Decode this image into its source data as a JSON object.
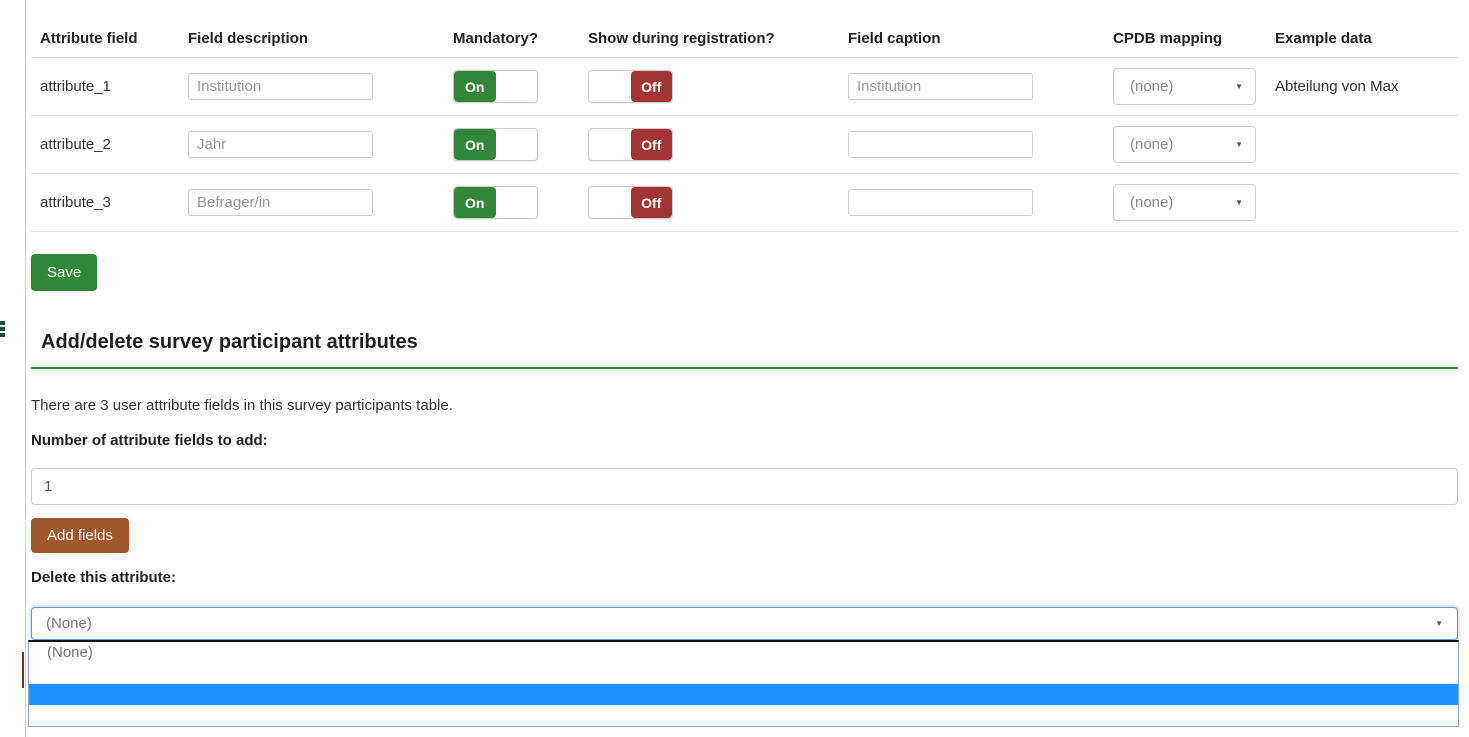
{
  "attributes_table": {
    "headers": [
      "Attribute field",
      "Field description",
      "Mandatory?",
      "Show during registration?",
      "Field caption",
      "CPDB mapping",
      "Example data"
    ],
    "rows": [
      {
        "field": "attribute_1",
        "description": "Institution",
        "mandatory": "On",
        "show_during_registration": "Off",
        "caption": "Institution",
        "cpdb_mapping": "(none)",
        "example": "Abteilung von Max"
      },
      {
        "field": "attribute_2",
        "description": "Jahr",
        "mandatory": "On",
        "show_during_registration": "Off",
        "caption": "",
        "cpdb_mapping": "(none)",
        "example": ""
      },
      {
        "field": "attribute_3",
        "description": "Befrager/in",
        "mandatory": "On",
        "show_during_registration": "Off",
        "caption": "",
        "cpdb_mapping": "(none)",
        "example": ""
      }
    ],
    "save_button": "Save"
  },
  "add_delete_section": {
    "heading": "Add/delete survey participant attributes",
    "info_text": "There are 3 user attribute fields in this survey participants table.",
    "add_count_label": "Number of attribute fields to add:",
    "add_count_value": "1",
    "add_button": "Add fields",
    "delete_label": "Delete this attribute:",
    "delete_select_value": "(None)",
    "dropdown_options": [
      "(None)",
      "",
      "",
      ""
    ]
  },
  "icons": {
    "dropdown_arrow": "▼"
  },
  "colors": {
    "toggle_on_green": "#328637",
    "toggle_off_red": "#a33434",
    "save_green": "#328637",
    "add_fields_brown": "#a1562c",
    "heading_underline_green": "#328637",
    "focus_border_blue": "#5b9dd9",
    "option_highlight_blue": "#1e90ff"
  }
}
